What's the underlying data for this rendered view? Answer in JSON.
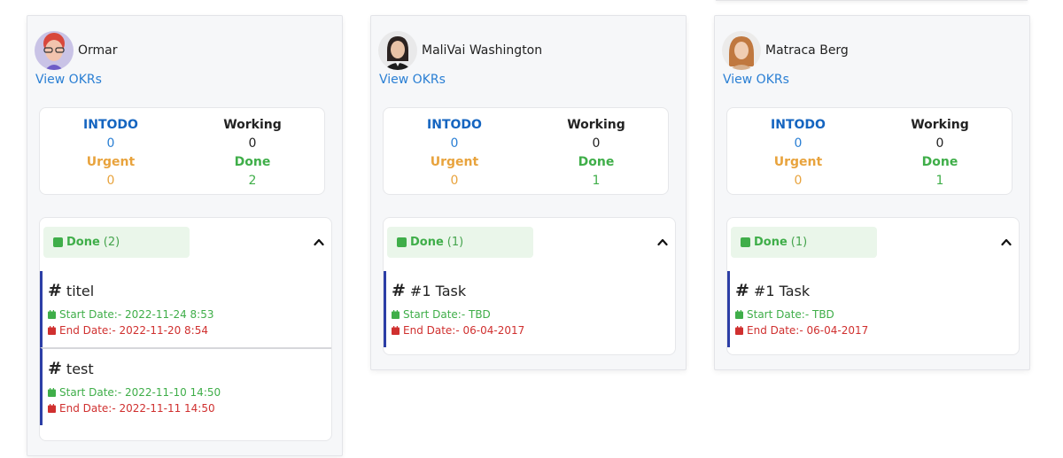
{
  "columns": [
    {
      "user": "Ormar",
      "avatar_icon": "avatar-man-icon",
      "okr_link": "View OKRs",
      "stats": {
        "intodo_label": "INTODO",
        "intodo_value": "0",
        "working_label": "Working",
        "working_value": "0",
        "urgent_label": "Urgent",
        "urgent_value": "0",
        "done_label": "Done",
        "done_value": "2"
      },
      "done_group": {
        "label": "Done",
        "count": "(2)"
      },
      "tasks": [
        {
          "title": "titel",
          "start": "Start Date:- 2022-11-24 8:53",
          "end": "End Date:- 2022-11-20 8:54"
        },
        {
          "title": "test",
          "start": "Start Date:- 2022-11-10 14:50",
          "end": "End Date:- 2022-11-11 14:50"
        }
      ]
    },
    {
      "user": "MaliVai Washington",
      "avatar_icon": "avatar-woman-icon",
      "okr_link": "View OKRs",
      "stats": {
        "intodo_label": "INTODO",
        "intodo_value": "0",
        "working_label": "Working",
        "working_value": "0",
        "urgent_label": "Urgent",
        "urgent_value": "0",
        "done_label": "Done",
        "done_value": "1"
      },
      "done_group": {
        "label": "Done",
        "count": "(1)"
      },
      "tasks": [
        {
          "title": "#1 Task",
          "start": "Start Date:- TBD",
          "end": "End Date:- 06-04-2017"
        }
      ]
    },
    {
      "user": "Matraca Berg",
      "avatar_icon": "avatar-woman-icon",
      "okr_link": "View OKRs",
      "stats": {
        "intodo_label": "INTODO",
        "intodo_value": "0",
        "working_label": "Working",
        "working_value": "0",
        "urgent_label": "Urgent",
        "urgent_value": "0",
        "done_label": "Done",
        "done_value": "1"
      },
      "done_group": {
        "label": "Done",
        "count": "(1)"
      },
      "tasks": [
        {
          "title": "#1 Task",
          "start": "Start Date:- TBD",
          "end": "End Date:- 06-04-2017"
        }
      ]
    }
  ],
  "colors": {
    "link": "#2a7fd4",
    "intodo": "#1565c0",
    "urgent": "#e8a33d",
    "done": "#3fae49",
    "end_date": "#d0302f",
    "task_accent": "#2c3ea6"
  },
  "icons": {
    "hash": "#",
    "calendar": "calendar-icon",
    "chevron": "chevron-up-icon",
    "done_square": "square-icon"
  }
}
